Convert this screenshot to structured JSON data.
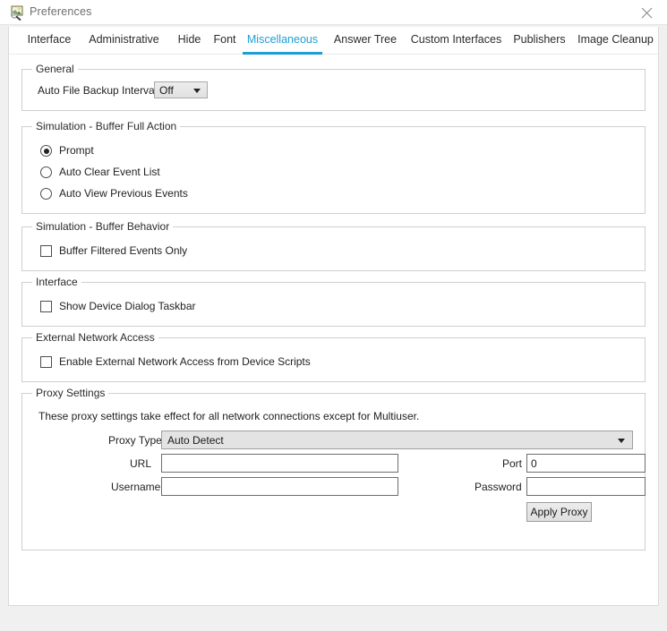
{
  "window": {
    "title": "Preferences",
    "icon": "preferences-image-magnifier-icon",
    "close_label": "close-icon",
    "accent_color": "#1e9fd4"
  },
  "tabs": [
    {
      "label": "Interface",
      "active": false
    },
    {
      "label": "Administrative",
      "active": false
    },
    {
      "label": "Hide",
      "active": false
    },
    {
      "label": "Font",
      "active": false
    },
    {
      "label": "Miscellaneous",
      "active": true
    },
    {
      "label": "Answer Tree",
      "active": false
    },
    {
      "label": "Custom Interfaces",
      "active": false
    },
    {
      "label": "Publishers",
      "active": false
    },
    {
      "label": "Image Cleanup",
      "active": false
    }
  ],
  "general": {
    "legend": "General",
    "backup_interval_label": "Auto File Backup Interval",
    "backup_interval_value": "Off",
    "backup_interval_options": [
      "Off"
    ]
  },
  "buffer_full_action": {
    "legend": "Simulation - Buffer Full Action",
    "options": [
      {
        "label": "Prompt",
        "selected": true
      },
      {
        "label": "Auto Clear Event List",
        "selected": false
      },
      {
        "label": "Auto View Previous Events",
        "selected": false
      }
    ]
  },
  "buffer_behavior": {
    "legend": "Simulation - Buffer Behavior",
    "checkbox_label": "Buffer Filtered Events Only",
    "checked": false
  },
  "interface_section": {
    "legend": "Interface",
    "checkbox_label": "Show Device Dialog Taskbar",
    "checked": false
  },
  "external_network": {
    "legend": "External Network Access",
    "checkbox_label": "Enable External Network Access from Device Scripts",
    "checked": false
  },
  "proxy": {
    "legend": "Proxy Settings",
    "note": "These proxy settings take effect for all network connections except for Multiuser.",
    "type_label": "Proxy Type",
    "type_value": "Auto Detect",
    "type_options": [
      "Auto Detect"
    ],
    "url_label": "URL",
    "url_value": "",
    "url_placeholder": "",
    "port_label": "Port",
    "port_value": "0",
    "port_placeholder": "",
    "username_label": "Username",
    "username_value": "",
    "username_placeholder": "",
    "password_label": "Password",
    "password_value": "",
    "password_placeholder": "",
    "apply_label": "Apply Proxy"
  }
}
